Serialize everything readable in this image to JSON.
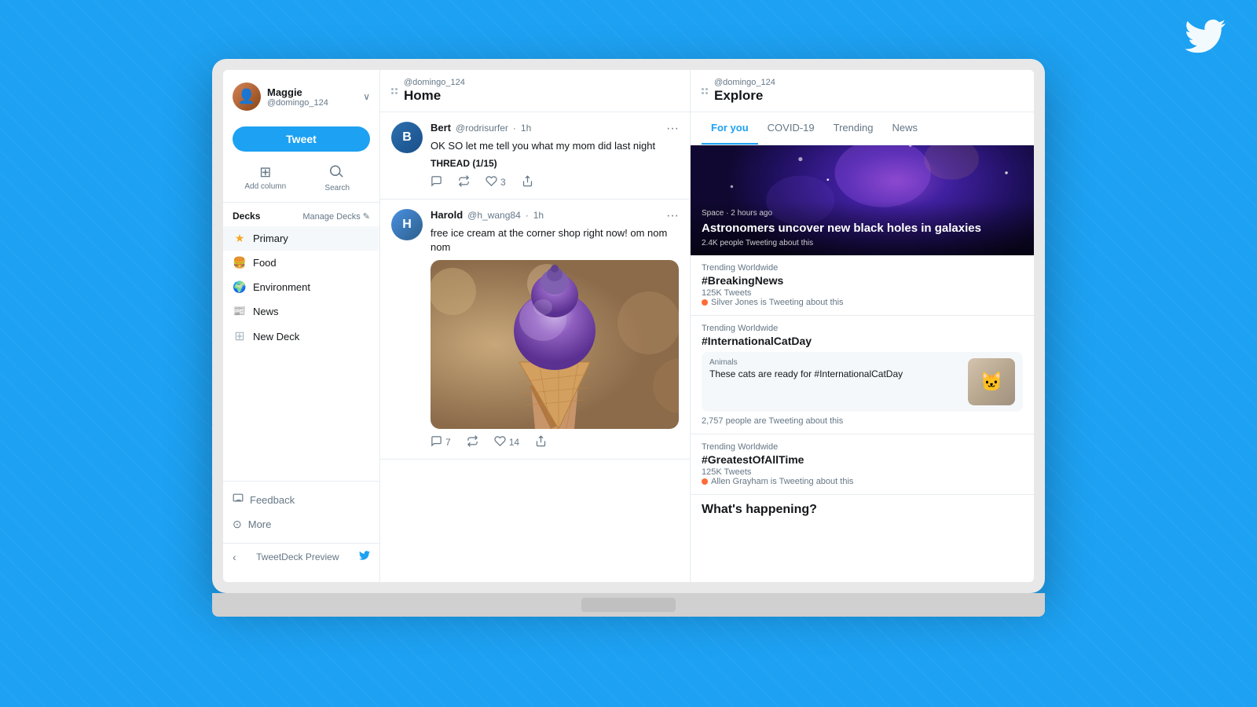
{
  "background": {
    "color": "#1da1f2"
  },
  "twitter_bird": "🐦",
  "laptop": {
    "screen": {
      "sidebar": {
        "user": {
          "name": "Maggie",
          "handle": "@domingo_124"
        },
        "tweet_button": "Tweet",
        "actions": [
          {
            "icon": "⊞",
            "label": "Add column"
          },
          {
            "icon": "🔍",
            "label": "Search"
          }
        ],
        "decks_title": "Decks",
        "manage_decks": "Manage Decks",
        "decks": [
          {
            "icon": "★",
            "label": "Primary",
            "active": true,
            "color": "#f5a623"
          },
          {
            "icon": "🍔",
            "label": "Food",
            "active": false
          },
          {
            "icon": "🌍",
            "label": "Environment",
            "active": false
          },
          {
            "icon": "📰",
            "label": "News",
            "active": false
          },
          {
            "icon": "⊞",
            "label": "New Deck",
            "active": false
          }
        ],
        "footer": [
          {
            "icon": "💬",
            "label": "Feedback"
          },
          {
            "icon": "⋯",
            "label": "More"
          }
        ],
        "tweetdeck_preview": {
          "label": "TweetDeck Preview",
          "arrow": "‹"
        }
      },
      "home_column": {
        "user_label": "@domingo_124",
        "title": "Home",
        "tweets": [
          {
            "author": "Bert",
            "handle": "@rodrisurfer",
            "time": "1h",
            "text": "OK SO let me tell you what my mom did last night",
            "thread": "THREAD (1/15)",
            "actions": {
              "reply": "",
              "retweet": "",
              "like": "3",
              "share": ""
            }
          },
          {
            "author": "Harold",
            "handle": "@h_wang84",
            "time": "1h",
            "text": "free ice cream at the corner shop right now! om nom nom",
            "has_image": true,
            "actions": {
              "reply": "7",
              "retweet": "",
              "like": "14",
              "share": ""
            }
          }
        ]
      },
      "explore_column": {
        "user_label": "@domingo_124",
        "title": "Explore",
        "tabs": [
          {
            "label": "For you",
            "active": true
          },
          {
            "label": "COVID-19",
            "active": false
          },
          {
            "label": "Trending",
            "active": false
          },
          {
            "label": "News",
            "active": false
          }
        ],
        "hero": {
          "category": "Space · 2 hours ago",
          "title": "Astronomers uncover new black holes in galaxies",
          "stats": "2.4K people Tweeting about this"
        },
        "trending_items": [
          {
            "label": "Trending Worldwide",
            "tag": "#BreakingNews",
            "count": "125K Tweets",
            "attribution": "Silver Jones is Tweeting about this"
          },
          {
            "label": "Trending Worldwide",
            "tag": "#InternationalCatDay",
            "card": {
              "category": "Animals",
              "title": "These cats are ready for #InternationalCatDay"
            },
            "count": "",
            "people_count": "2,757 people are Tweeting about this"
          },
          {
            "label": "Trending Worldwide",
            "tag": "#GreatestOfAllTime",
            "count": "125K Tweets",
            "attribution": "Allen Grayham is Tweeting about this"
          }
        ],
        "whats_happening": "What's happening?"
      }
    }
  }
}
